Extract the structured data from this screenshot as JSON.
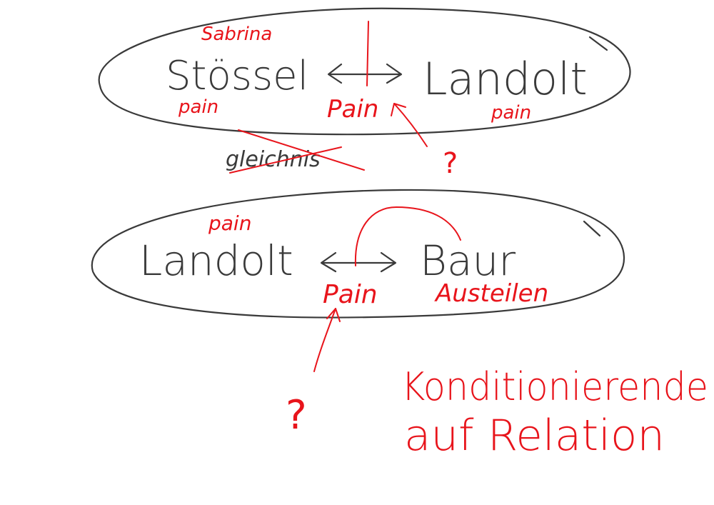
{
  "top_group": {
    "first_name": "Sabrina",
    "left_name": "Stössel",
    "right_name": "Landolt",
    "left_role": "pain",
    "middle_role": "Pain",
    "right_role": "pain",
    "question": "?"
  },
  "crossed_word": "gleichnis",
  "bottom_group": {
    "left_role_top": "pain",
    "left_name": "Landolt",
    "right_name": "Baur",
    "left_role": "Pain",
    "right_role": "Austeilen",
    "question": "?"
  },
  "note": {
    "line1": "Konditionierende",
    "line2": "auf Relation"
  },
  "colors": {
    "dark_ink": "#3a3a3a",
    "red_ink": "#e8141b"
  }
}
